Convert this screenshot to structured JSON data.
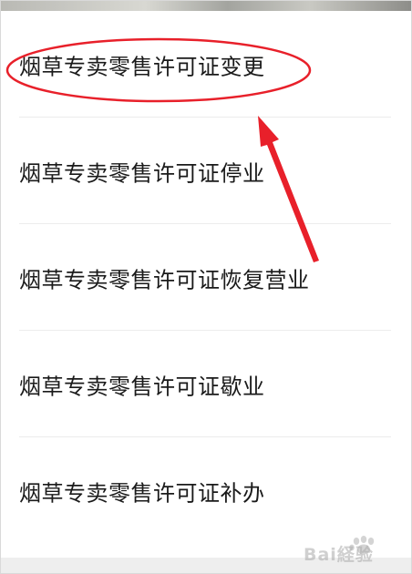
{
  "menu": {
    "items": [
      {
        "label": "烟草专卖零售许可证变更"
      },
      {
        "label": "烟草专卖零售许可证停业"
      },
      {
        "label": "烟草专卖零售许可证恢复营业"
      },
      {
        "label": "烟草专卖零售许可证歇业"
      },
      {
        "label": "烟草专卖零售许可证补办"
      }
    ]
  },
  "annotation": {
    "highlight_color": "#e8202a",
    "highlighted_item": "烟草专卖零售许可证变更",
    "shapes": [
      "ellipse",
      "arrow"
    ]
  },
  "watermark": {
    "text": "Bai経验"
  },
  "colors": {
    "background": "#ffffff",
    "text": "#1a1a1a",
    "divider": "#ececec"
  }
}
